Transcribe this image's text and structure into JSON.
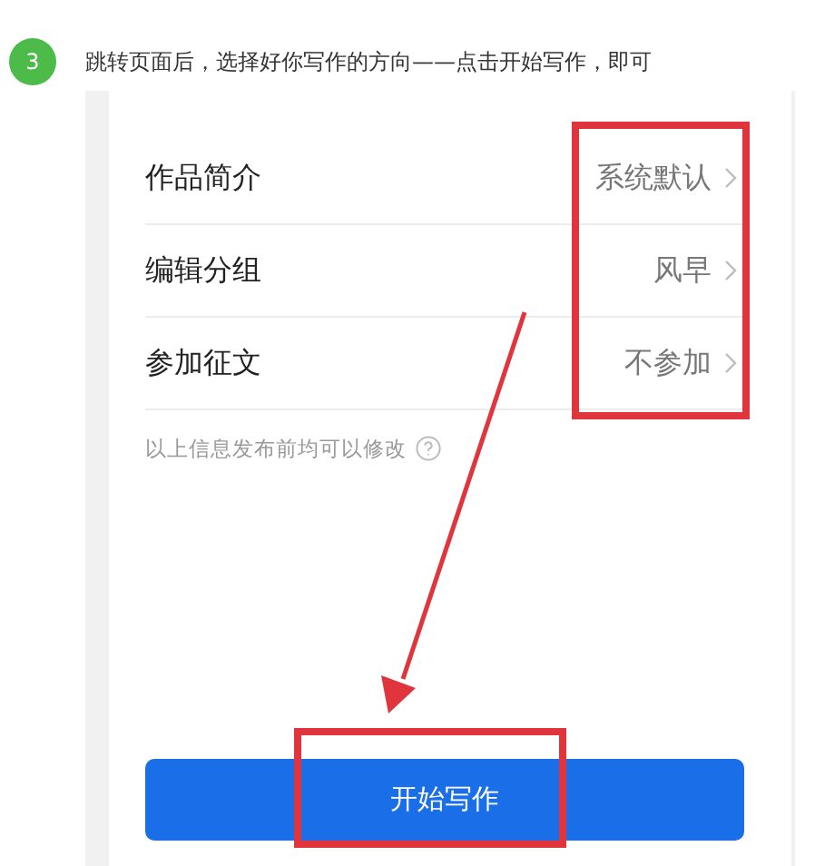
{
  "step": {
    "number": "3",
    "text": "跳转页面后，选择好你写作的方向——点击开始写作，即可"
  },
  "settings": [
    {
      "label": "作品简介",
      "value": "系统默认"
    },
    {
      "label": "编辑分组",
      "value": "风早"
    },
    {
      "label": "参加征文",
      "value": "不参加"
    }
  ],
  "hint": "以上信息发布前均可以修改",
  "button": {
    "label": "开始写作"
  }
}
